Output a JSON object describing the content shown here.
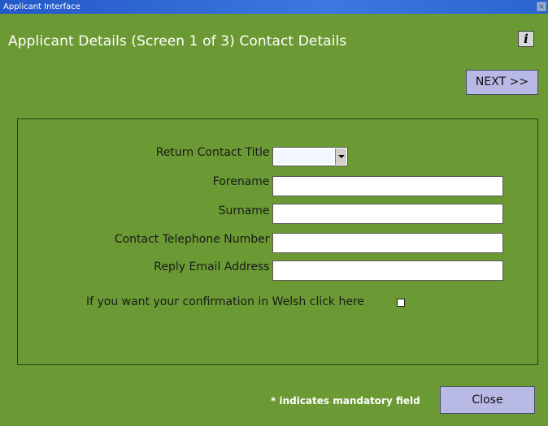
{
  "window": {
    "title": "Applicant Interface",
    "close_glyph": "×"
  },
  "header": {
    "title": "Applicant Details (Screen 1 of 3) Contact Details",
    "info_icon": "i",
    "next_label": "NEXT >>"
  },
  "form": {
    "title_label": "Return Contact Title *",
    "title_value": "",
    "forename_label": "Forename *",
    "forename_value": "",
    "surname_label": "Surname *",
    "surname_value": "",
    "phone_label": "Contact Telephone Number *",
    "phone_value": "",
    "email_label": "Reply Email Address *",
    "email_value": "",
    "welsh_label": "If you want your confirmation in Welsh click here",
    "welsh_checked": false
  },
  "footer": {
    "mandatory_note": "* indicates mandatory field",
    "close_label": "Close"
  },
  "colors": {
    "background": "#6b9a34",
    "button": "#b9b9e6",
    "titlebar": "#2d62d4"
  }
}
